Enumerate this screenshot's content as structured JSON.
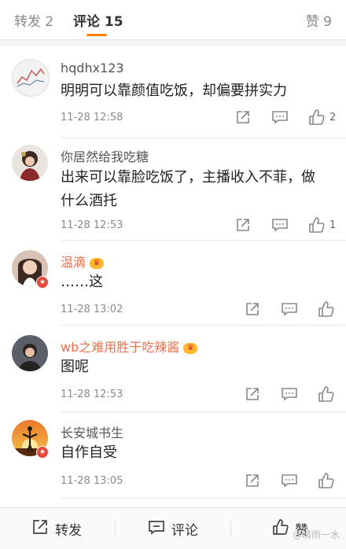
{
  "tabs": {
    "repost": "转发 2",
    "comment": "评论 15",
    "like": "赞 9"
  },
  "comments": [
    {
      "name": "hqdhx123",
      "text": "明明可以靠颜值吃饭，却偏要拼实力",
      "time": "11-28 12:58",
      "likes": "2"
    },
    {
      "name": "你居然给我吃糖",
      "text": "出来可以靠脸吃饭了，主播收入不菲，做什么酒托",
      "time": "11-28 12:53",
      "likes": "1"
    },
    {
      "name": "温滴",
      "text": "……这",
      "time": "11-28 13:02",
      "likes": ""
    },
    {
      "name": "wb之难用胜于吃辣酱",
      "text": "图呢",
      "time": "11-28 12:53",
      "likes": ""
    },
    {
      "name": "长安城书生",
      "text": "自作自受",
      "time": "11-28 13:05",
      "likes": ""
    }
  ],
  "bottom": {
    "repost": "转发",
    "comment": "评论",
    "like": "赞"
  },
  "watermark": "@晴雨一水",
  "colors": {
    "accent": "#ff8200",
    "vip_name": "#eb7350",
    "badge": "#e8483a"
  }
}
